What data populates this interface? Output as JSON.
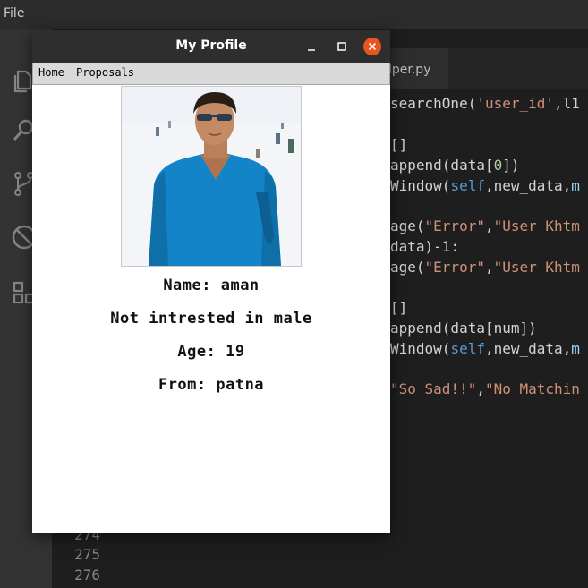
{
  "editor": {
    "menu_file": "File",
    "tab_label": "lper.py",
    "code_lines": [
      {
        "parts": [
          {
            "t": "searchOne(",
            "c": ""
          },
          {
            "t": "'user_id'",
            "c": "str"
          },
          {
            "t": ",l1",
            "c": ""
          }
        ]
      },
      {
        "parts": [
          {
            "t": "[]",
            "c": ""
          }
        ]
      },
      {
        "parts": [
          {
            "t": "append(data[",
            "c": ""
          },
          {
            "t": "0",
            "c": "num"
          },
          {
            "t": "])",
            "c": ""
          }
        ]
      },
      {
        "parts": [
          {
            "t": "Window(",
            "c": ""
          },
          {
            "t": "self",
            "c": "kw"
          },
          {
            "t": ",new_data,",
            "c": ""
          },
          {
            "t": "m",
            "c": "var"
          }
        ]
      },
      {
        "parts": [
          {
            "t": "age(",
            "c": ""
          },
          {
            "t": "\"Error\"",
            "c": "str"
          },
          {
            "t": ",",
            "c": ""
          },
          {
            "t": "\"User Khtm",
            "c": "str"
          }
        ]
      },
      {
        "parts": [
          {
            "t": "data)-",
            "c": ""
          },
          {
            "t": "1",
            "c": "num"
          },
          {
            "t": ":",
            "c": ""
          }
        ]
      },
      {
        "parts": [
          {
            "t": "age(",
            "c": ""
          },
          {
            "t": "\"Error\"",
            "c": "str"
          },
          {
            "t": ",",
            "c": ""
          },
          {
            "t": "\"User Khtm",
            "c": "str"
          }
        ]
      },
      {
        "parts": [
          {
            "t": "[]",
            "c": ""
          }
        ]
      },
      {
        "parts": [
          {
            "t": "append(data[num])",
            "c": ""
          }
        ]
      },
      {
        "parts": [
          {
            "t": "Window(",
            "c": ""
          },
          {
            "t": "self",
            "c": "kw"
          },
          {
            "t": ",new_data,",
            "c": ""
          },
          {
            "t": "m",
            "c": "var"
          }
        ]
      },
      {
        "parts": [
          {
            "t": "\"So Sad!!\"",
            "c": "str"
          },
          {
            "t": ",",
            "c": ""
          },
          {
            "t": "\"No Matchin",
            "c": "str"
          }
        ]
      }
    ],
    "line_numbers": [
      "274",
      "275",
      "276"
    ]
  },
  "window": {
    "title": "My Profile",
    "menu": {
      "home": "Home",
      "proposals": "Proposals"
    }
  },
  "profile": {
    "name": "Name: aman",
    "interest": "Not intrested in male",
    "age": "Age: 19",
    "from": "From: patna"
  },
  "colors": {
    "close_button": "#e95420",
    "window_titlebar": "#2e2e2e",
    "menubar": "#d9d9d9"
  }
}
